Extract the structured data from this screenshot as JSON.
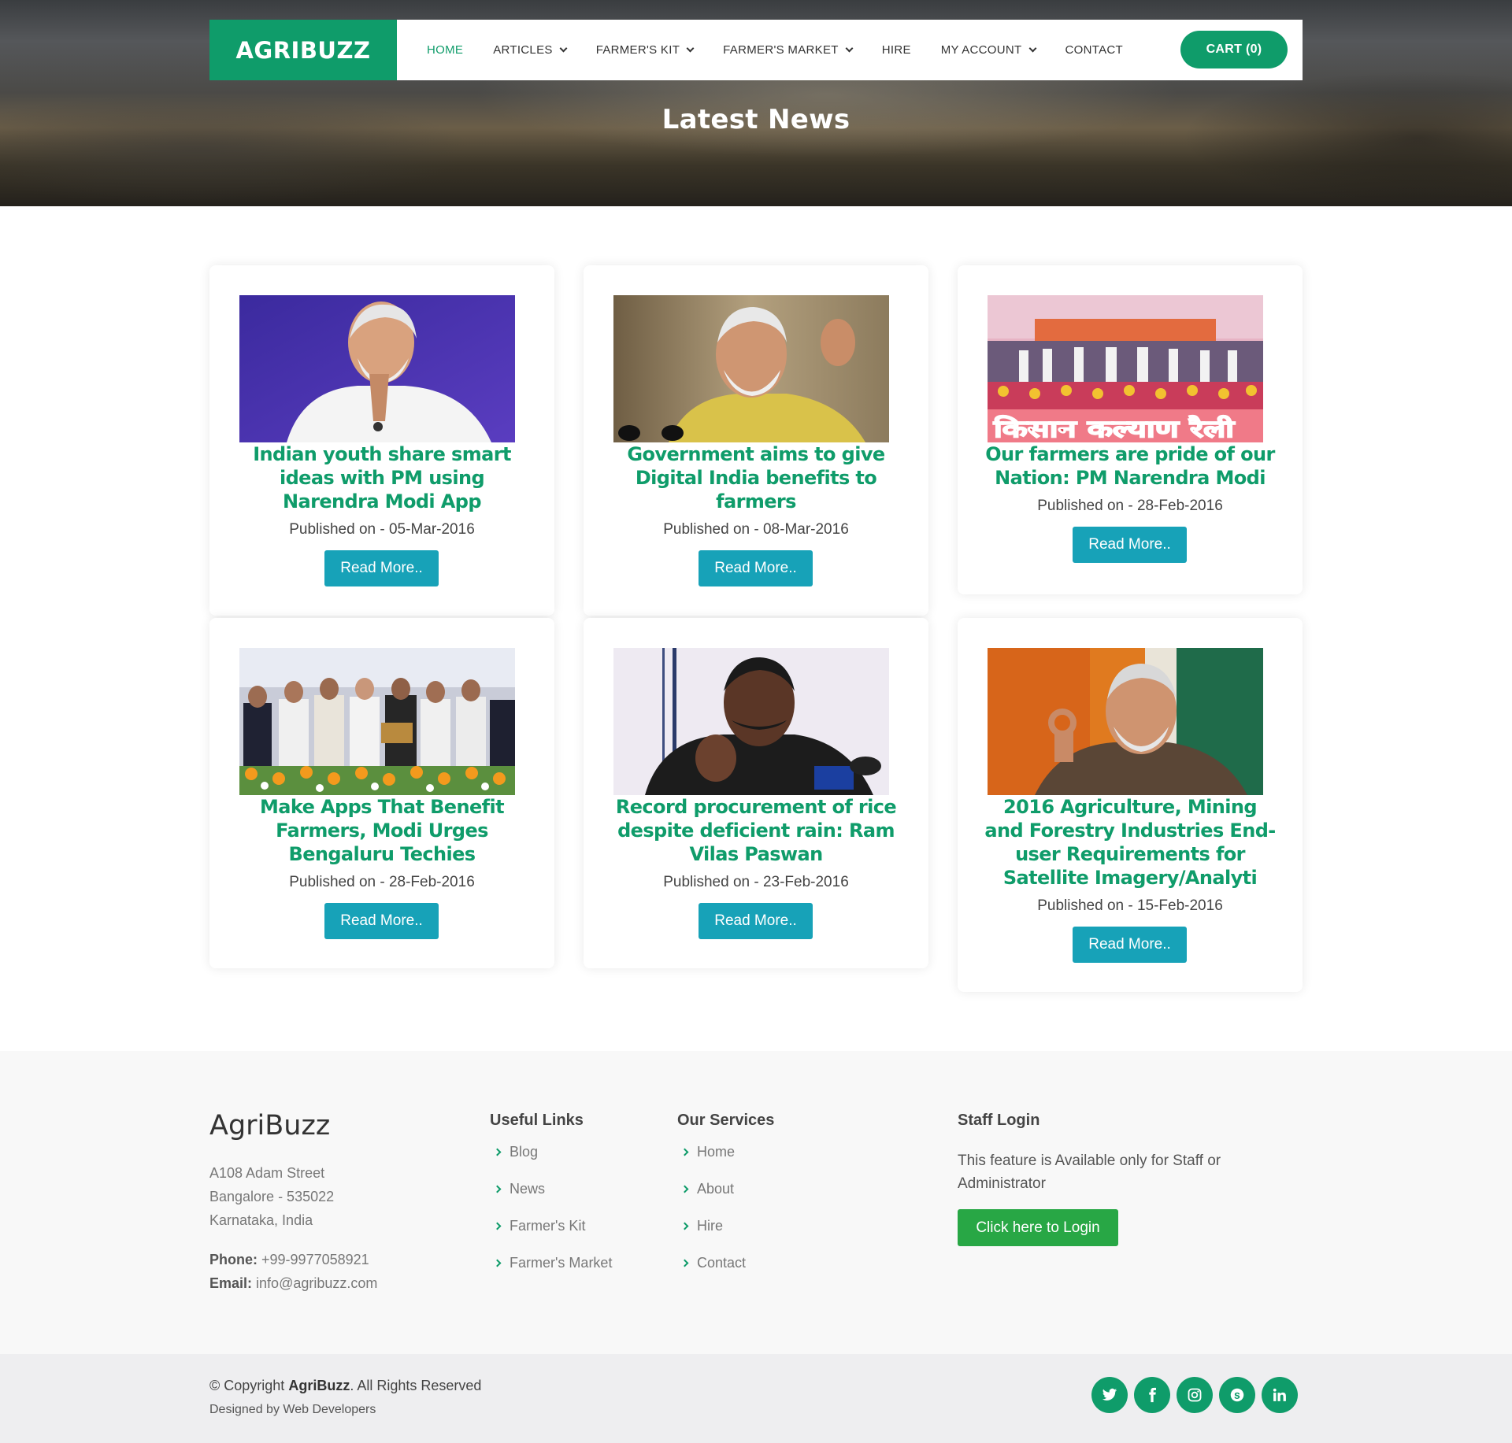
{
  "brand": {
    "logo_text": "AGRIBUZZ",
    "color": "#0f9c6a"
  },
  "nav": {
    "items": [
      {
        "label": "HOME",
        "active": true,
        "dropdown": false
      },
      {
        "label": "ARTICLES",
        "active": false,
        "dropdown": true
      },
      {
        "label": "FARMER'S KIT",
        "active": false,
        "dropdown": true
      },
      {
        "label": "FARMER'S MARKET",
        "active": false,
        "dropdown": true
      },
      {
        "label": "HIRE",
        "active": false,
        "dropdown": false
      },
      {
        "label": "MY ACCOUNT",
        "active": false,
        "dropdown": true
      },
      {
        "label": "CONTACT",
        "active": false,
        "dropdown": false
      }
    ],
    "cart_label": "CART (0)"
  },
  "hero": {
    "title": "Latest News"
  },
  "articles": [
    {
      "title": "Indian youth share smart ideas with PM using Narendra Modi App",
      "date": "Published on - 05-Mar-2016",
      "button": "Read More.."
    },
    {
      "title": "Government aims to give Digital India benefits to farmers",
      "date": "Published on - 08-Mar-2016",
      "button": "Read More.."
    },
    {
      "title": "Our farmers are pride of our Nation: PM Narendra Modi",
      "date": "Published on - 28-Feb-2016",
      "button": "Read More..",
      "image_banner_text": "किसान कल्याण रैली"
    },
    {
      "title": "Make Apps That Benefit Farmers, Modi Urges Bengaluru Techies",
      "date": "Published on - 28-Feb-2016",
      "button": "Read More.."
    },
    {
      "title": "Record procurement of rice despite deficient rain: Ram Vilas Paswan",
      "date": "Published on - 23-Feb-2016",
      "button": "Read More.."
    },
    {
      "title": "2016 Agriculture, Mining and Forestry Industries End-user Requirements for Satellite Imagery/Analyti",
      "date": "Published on - 15-Feb-2016",
      "button": "Read More.."
    }
  ],
  "footer": {
    "brand": "AgriBuzz",
    "address": [
      "A108 Adam Street",
      "Bangalore - 535022",
      "Karnataka, India"
    ],
    "phone_label": "Phone:",
    "phone": "+99-9977058921",
    "email_label": "Email:",
    "email": "info@agribuzz.com",
    "useful_links": {
      "title": "Useful Links",
      "items": [
        "Blog",
        "News",
        "Farmer's Kit",
        "Farmer's Market"
      ]
    },
    "services": {
      "title": "Our Services",
      "items": [
        "Home",
        "About",
        "Hire",
        "Contact"
      ]
    },
    "staff": {
      "title": "Staff Login",
      "text": "This feature is Available only for Staff or Administrator",
      "button": "Click here to Login"
    }
  },
  "bottom": {
    "copyright_prefix": "© Copyright",
    "copyright_brand": "AgriBuzz",
    "copyright_suffix": ". All Rights Reserved",
    "designed_by": "Designed by Web Developers",
    "social_icons": [
      "twitter-icon",
      "facebook-icon",
      "instagram-icon",
      "skype-icon",
      "linkedin-icon"
    ]
  }
}
